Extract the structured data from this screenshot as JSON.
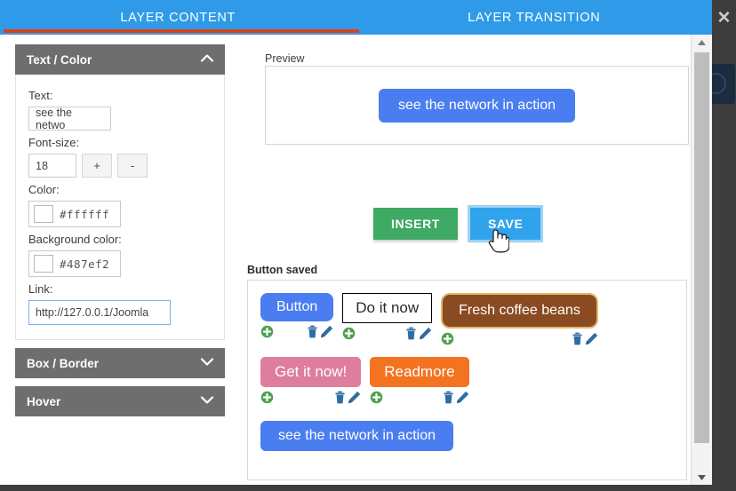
{
  "window": {
    "close_label": "✕"
  },
  "tabs": [
    {
      "label": "LAYER CONTENT",
      "active": true
    },
    {
      "label": "LAYER TRANSITION",
      "active": false
    }
  ],
  "sidebar": {
    "panels": [
      {
        "title": "Text / Color",
        "state": "expanded",
        "chevron": "chevron-up-icon"
      },
      {
        "title": "Box / Border",
        "state": "collapsed",
        "chevron": "chevron-down-icon"
      },
      {
        "title": "Hover",
        "state": "collapsed",
        "chevron": "chevron-down-icon"
      }
    ],
    "fields": {
      "text_label": "Text:",
      "text_value": "see the netwo",
      "fontsize_label": "Font-size:",
      "fontsize_value": "18",
      "plus_label": "+",
      "minus_label": "-",
      "color_label": "Color:",
      "color_value": "#ffffff",
      "bgcolor_label": "Background color:",
      "bgcolor_value": "#487ef2",
      "link_label": "Link:",
      "link_value": "http://127.0.0.1/Joomla"
    }
  },
  "main": {
    "preview_label": "Preview",
    "preview_button_text": "see the network in action",
    "preview_button_bg": "#4a7ef0",
    "preview_button_color": "#ffffff",
    "insert_label": "INSERT",
    "save_label": "SAVE",
    "insert_color": "#3faa64",
    "save_color": "#31a3ec",
    "saved_label": "Button saved",
    "saved_buttons": [
      {
        "label": "Button",
        "bg": "#4a7ef0",
        "color": "#ffffff",
        "border": "none",
        "radius": "8px",
        "font_size": "16px",
        "pad": "7px 18px"
      },
      {
        "label": "Do it now",
        "bg": "#ffffff",
        "color": "#2b2b2b",
        "border": "1px solid #000000",
        "radius": "0px",
        "font_size": "17px",
        "pad": "6px 14px"
      },
      {
        "label": "Fresh coffee beans",
        "bg": "#8a4a22",
        "color": "#ffffff",
        "border": "2px solid #e0b96a",
        "radius": "10px",
        "font_size": "16px",
        "pad": "9px 18px"
      },
      {
        "label": "Get it now!",
        "bg": "#de7e9c",
        "color": "#ffffff",
        "border": "none",
        "radius": "5px",
        "font_size": "17px",
        "pad": "7px 16px"
      },
      {
        "label": "Readmore",
        "bg": "#f37321",
        "color": "#ffffff",
        "border": "none",
        "radius": "5px",
        "font_size": "17px",
        "pad": "7px 16px"
      },
      {
        "label": "see the network in action",
        "bg": "#4a7ef0",
        "color": "#ffffff",
        "border": "none",
        "radius": "6px",
        "font_size": "16px",
        "pad": "8px 20px"
      }
    ],
    "row_icons": {
      "add": "plus-circle-icon",
      "delete": "trash-icon",
      "edit": "pencil-icon"
    }
  },
  "scrollbar": {
    "up": "▲",
    "down": "▼"
  }
}
